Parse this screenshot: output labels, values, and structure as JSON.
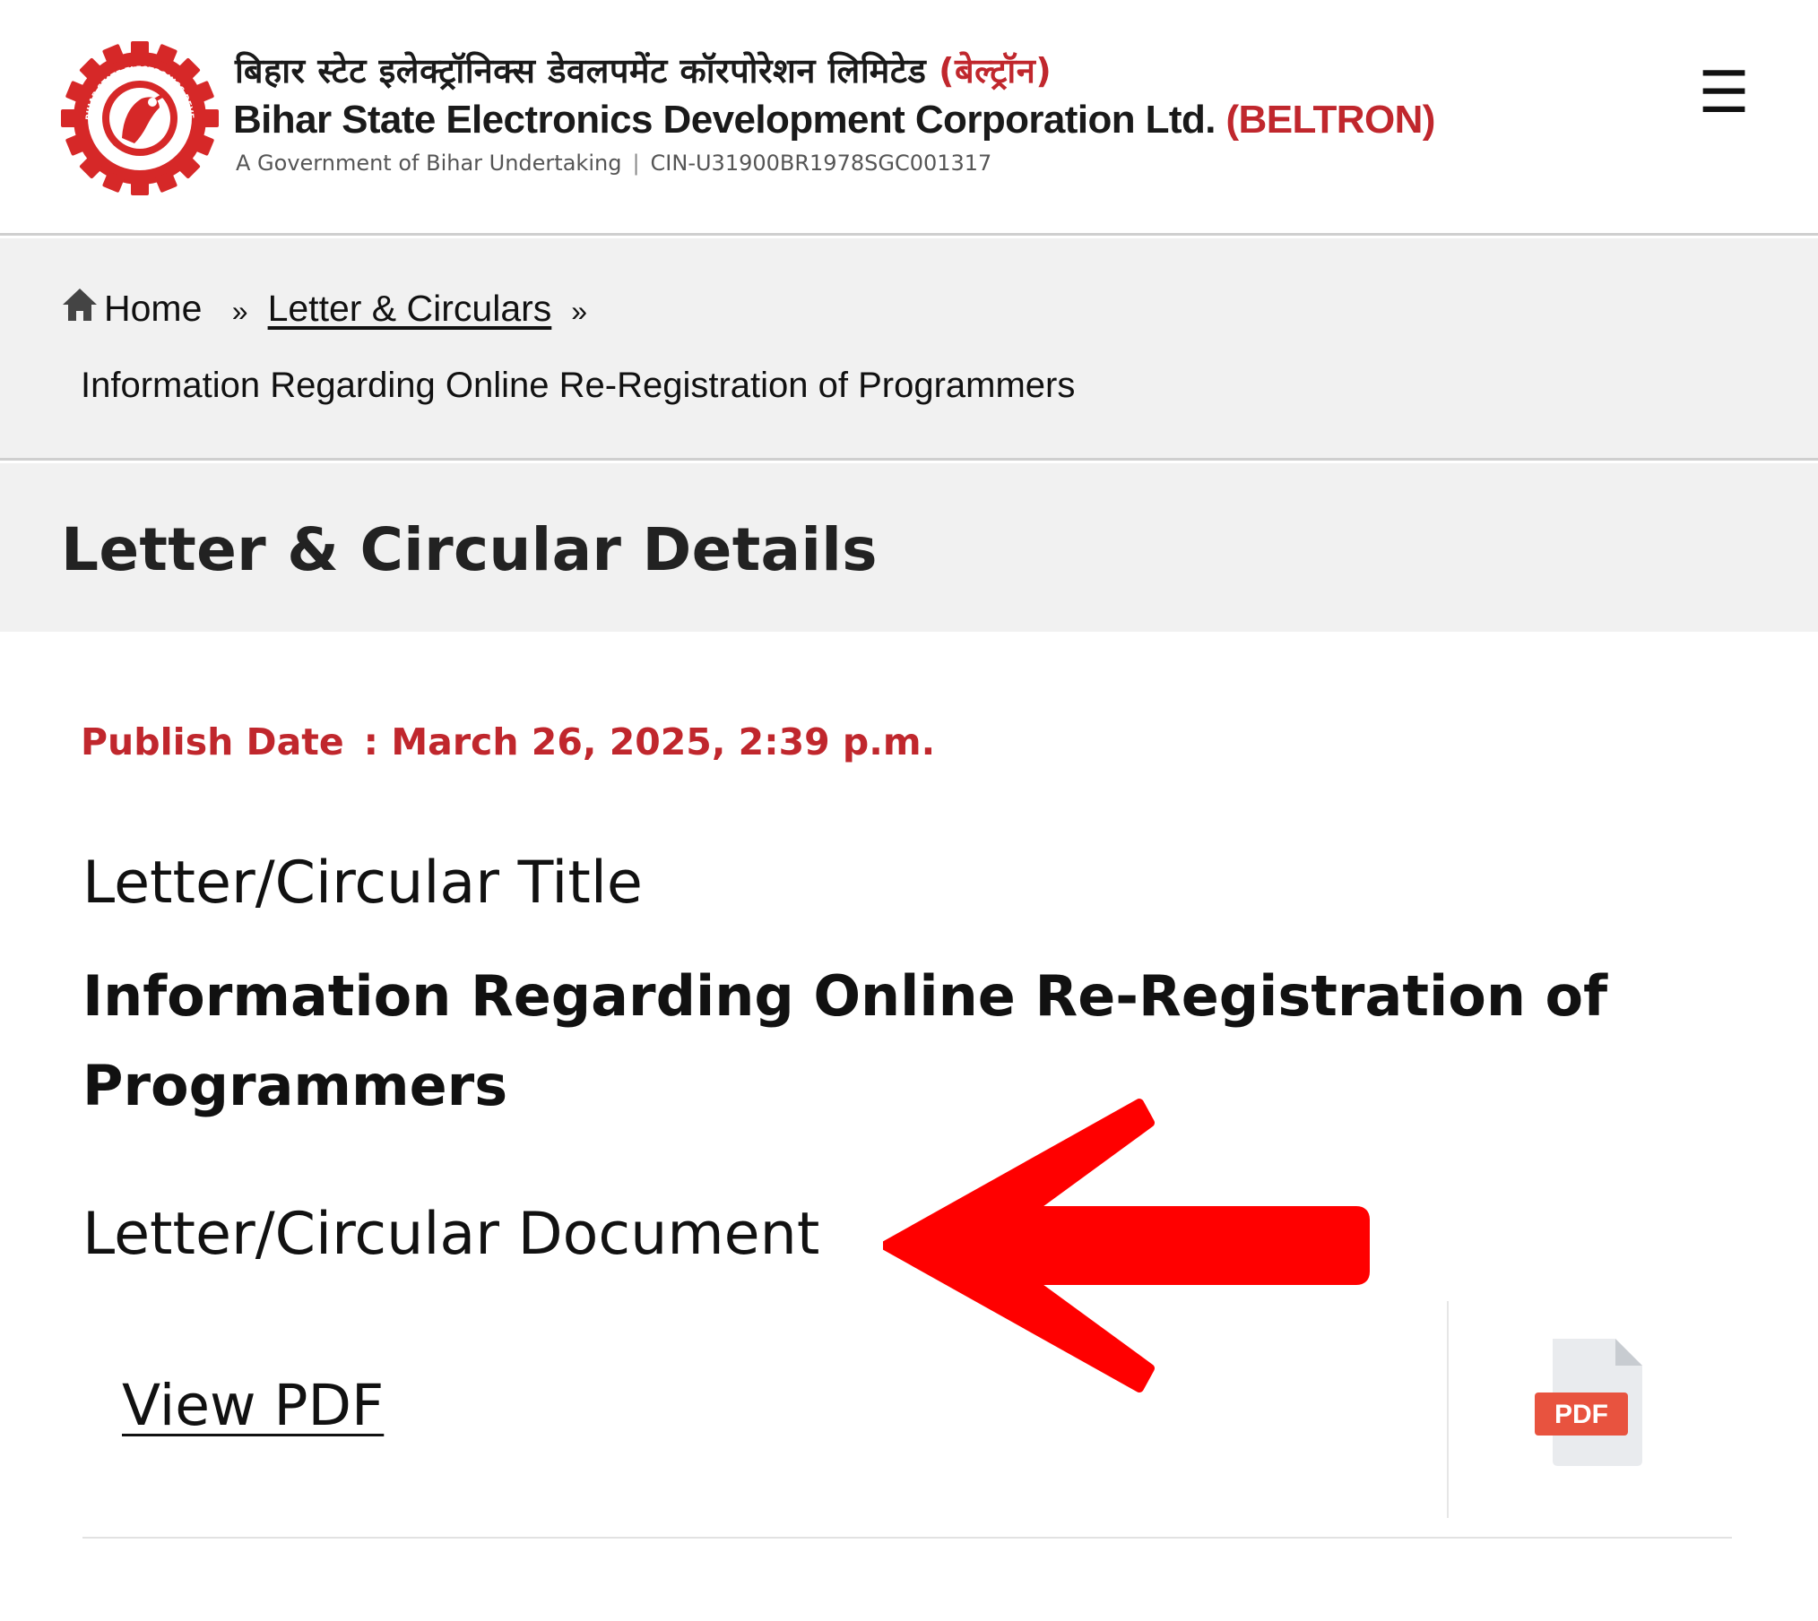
{
  "header": {
    "org_name_hindi": "बिहार स्टेट इलेक्ट्रॉनिक्स डेवलपमेंट कॉरपोरेशन लिमिटेड",
    "org_abbr_hindi": "(बेल्ट्रॉन)",
    "org_name_english": "Bihar State Electronics Development Corporation Ltd.",
    "org_abbr_english": "(BELTRON)",
    "tagline": "A Government of Bihar Undertaking",
    "separator": "|",
    "cin": "CIN-U31900BR1978SGC001317",
    "menu_icon": "hamburger-icon",
    "menu_glyph": "☰",
    "logo_icon": "beltron-logo",
    "logo_text": "BIHAR STATE ELECTRONICS DEVELOPMENT CORPORATION LIMITED"
  },
  "breadcrumb": {
    "home_icon": "home-icon",
    "home_label": "Home",
    "separator": "»",
    "parent_label": "Letter & Circulars",
    "current_label": "Information Regarding Online Re-Registration of Programmers"
  },
  "page": {
    "title": "Letter & Circular Details"
  },
  "details": {
    "publish_label": "Publish Date",
    "publish_colon": ":",
    "publish_value": "March 26, 2025, 2:39 p.m.",
    "title_label": "Letter/Circular Title",
    "circular_title": "Information Regarding Online Re-Registration of Programmers",
    "document_label": "Letter/Circular Document",
    "view_pdf_label": "View PDF",
    "pdf_icon": "pdf-file-icon",
    "pdf_badge": "PDF"
  },
  "annotation": {
    "arrow_icon": "red-arrow-left-icon"
  },
  "colors": {
    "brand_red": "#c0272d",
    "arrow_red": "#ff0000",
    "band_gray": "#f1f1f1",
    "pdf_badge_red": "#e8533f"
  }
}
